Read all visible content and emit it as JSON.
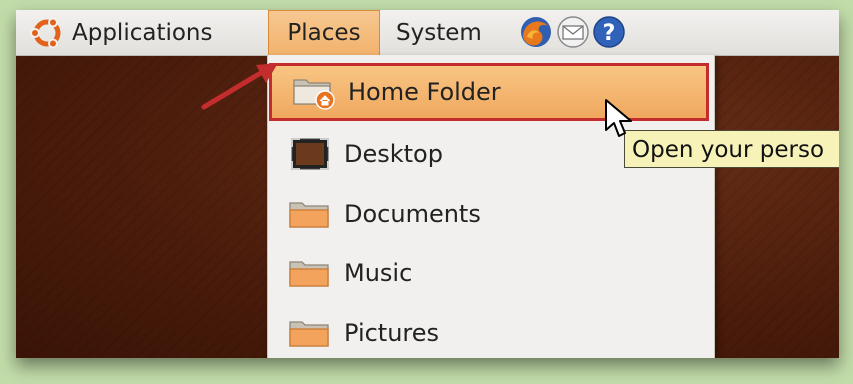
{
  "menubar": {
    "applications_label": "Applications",
    "places_label": "Places",
    "system_label": "System"
  },
  "places_menu": {
    "items": [
      {
        "label": "Home Folder"
      },
      {
        "label": "Desktop"
      },
      {
        "label": "Documents"
      },
      {
        "label": "Music"
      },
      {
        "label": "Pictures"
      }
    ]
  },
  "tooltip": {
    "text": "Open your perso"
  },
  "colors": {
    "highlight": "#f0a85f",
    "highlight_border": "#c42d2d",
    "arrow": "#c42d2d",
    "tooltip_bg": "#f7f2b8",
    "desktop_bg": "#4a1c0b"
  },
  "icons": [
    "ubuntu-logo-icon",
    "firefox-icon",
    "mail-icon",
    "help-icon",
    "home-folder-icon",
    "desktop-icon",
    "folder-icon",
    "mouse-pointer-icon",
    "annotation-arrow"
  ]
}
